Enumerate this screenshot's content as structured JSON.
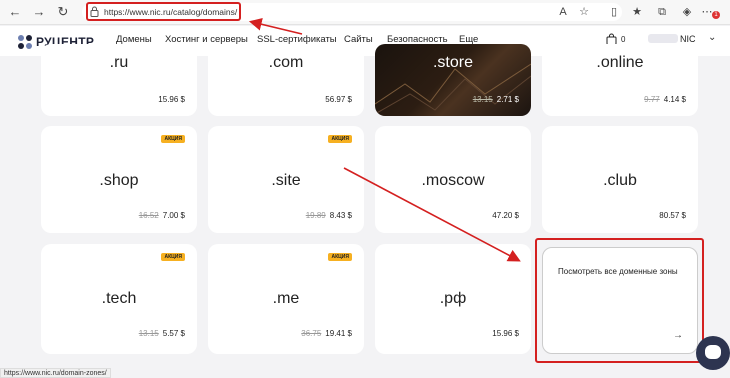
{
  "browser": {
    "url": "https://www.nic.ru/catalog/domains/",
    "status_url": "https://www.nic.ru/domain-zones/",
    "notification_count": "1"
  },
  "site": {
    "logo_text": "РУЦЕНТР",
    "nav": [
      "Домены",
      "Хостинг и серверы",
      "SSL-сертификаты",
      "Сайты",
      "Безопасность",
      "Еще"
    ],
    "cart_count": "0",
    "user_name": "NIC"
  },
  "zones": [
    {
      "name": ".ru",
      "price": "15.96 $"
    },
    {
      "name": ".com",
      "price": "56.97 $"
    },
    {
      "name": ".store",
      "old_price": "13.15",
      "price": "2.71 $"
    },
    {
      "name": ".online",
      "old_price": "9.77",
      "price": "4.14 $"
    },
    {
      "name": ".shop",
      "badge": "АКЦИЯ",
      "old_price": "16.52",
      "price": "7.00 $"
    },
    {
      "name": ".site",
      "badge": "АКЦИЯ",
      "old_price": "19.89",
      "price": "8.43 $"
    },
    {
      "name": ".moscow",
      "price": "47.20 $"
    },
    {
      "name": ".club",
      "price": "80.57 $"
    },
    {
      "name": ".tech",
      "badge": "АКЦИЯ",
      "old_price": "13.15",
      "price": "5.57 $"
    },
    {
      "name": ".me",
      "badge": "АКЦИЯ",
      "old_price": "36.75",
      "price": "19.41 $"
    },
    {
      "name": ".рф",
      "price": "15.96 $"
    }
  ],
  "all_zones": {
    "label": "Посмотреть все доменные зоны",
    "arrow": "→"
  },
  "colors": {
    "highlight_red": "#d42020",
    "badge_yellow": "#f6b021",
    "brand_dark": "#1d2136"
  }
}
